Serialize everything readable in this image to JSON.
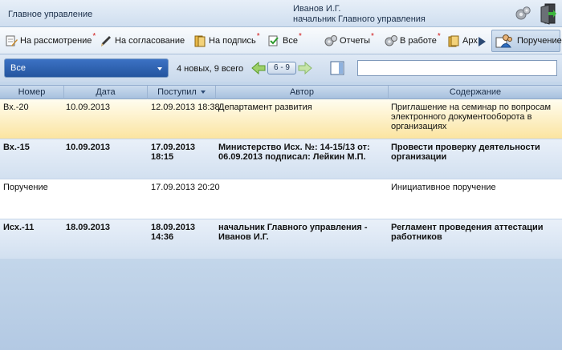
{
  "app": {
    "title": "Главное управление"
  },
  "user": {
    "name": "Иванов И.Г.",
    "position": "начальник Главного управления"
  },
  "icons": {
    "settings": "gear-icon",
    "exit": "exit-door-icon"
  },
  "toolbar": {
    "items": [
      {
        "label": "На рассмотрение",
        "icon": "document-pen-icon",
        "marked": true
      },
      {
        "label": "На согласование",
        "icon": "pen-icon",
        "marked": false
      },
      {
        "label": "На подпись",
        "icon": "folder-icon",
        "marked": true
      },
      {
        "label": "Все",
        "icon": "check-document-icon",
        "marked": true
      },
      {
        "label": "Отчеты",
        "icon": "gears-report-icon",
        "marked": true
      },
      {
        "label": "В работе",
        "icon": "gears-work-icon",
        "marked": true
      },
      {
        "label": "Арх",
        "icon": "archive-icon",
        "marked": false
      }
    ],
    "star": "*",
    "active": {
      "label": "Поручение",
      "icon": "assignment-users-icon"
    }
  },
  "filter": {
    "selected": "Все",
    "counter": "4 новых, 9 всего",
    "pager": "6 - 9",
    "search_value": ""
  },
  "grid": {
    "columns": [
      "Номер",
      "Дата",
      "Поступил",
      "Автор",
      "Содержание"
    ],
    "rows": [
      {
        "number": "Вх.-20",
        "date": "10.09.2013",
        "received": "12.09.2013 18:38",
        "author": "Департамент развития",
        "content": "Приглашение на семинар по вопросам электронного документооборота в организациях",
        "state": "selected"
      },
      {
        "number": "Вх.-15",
        "date": "10.09.2013",
        "received": "17.09.2013 18:15",
        "author": "Министерство Исх. №: 14-15/13 от: 06.09.2013 подписал: Лейкин М.П.",
        "content": "Провести проверку деятельности организации",
        "state": "new"
      },
      {
        "number": "Поручение",
        "date": "",
        "received": "17.09.2013 20:20",
        "author": "",
        "content": "Инициативное поручение",
        "state": "read"
      },
      {
        "number": "Исх.-11",
        "date": "18.09.2013",
        "received": "18.09.2013 14:36",
        "author": "начальник Главного управления - Иванов И.Г.",
        "content": "Регламент проведения аттестации работников",
        "state": "new"
      }
    ]
  },
  "colors": {
    "accent": "#2a5fad",
    "selected_row": "#fbe4a0",
    "marker": "#d01818"
  }
}
